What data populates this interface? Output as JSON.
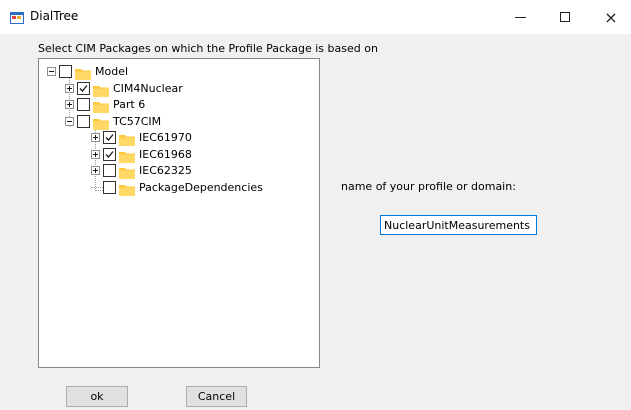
{
  "window": {
    "title": "DialTree",
    "icon": "app-window-icon",
    "controls": {
      "minimize": "minimize-icon",
      "maximize": "maximize-icon",
      "close": "×"
    }
  },
  "instruction": "Select CIM Packages on which the Profile Package is based on",
  "tree": {
    "nodes": [
      {
        "label": "Model",
        "checked": false,
        "expanded": true,
        "level": 0
      },
      {
        "label": "CIM4Nuclear",
        "checked": true,
        "expanded": false,
        "level": 1
      },
      {
        "label": "Part 6",
        "checked": false,
        "expanded": false,
        "level": 1
      },
      {
        "label": "TC57CIM",
        "checked": false,
        "expanded": true,
        "level": 1
      },
      {
        "label": "IEC61970",
        "checked": true,
        "expanded": false,
        "level": 2
      },
      {
        "label": "IEC61968",
        "checked": true,
        "expanded": false,
        "level": 2
      },
      {
        "label": "IEC62325",
        "checked": false,
        "expanded": false,
        "level": 2
      },
      {
        "label": "PackageDependencies",
        "checked": false,
        "expanded": null,
        "level": 2
      }
    ]
  },
  "profile": {
    "label": "name of your profile or domain:",
    "value": "NuclearUnitMeasurements"
  },
  "buttons": {
    "ok": "ok",
    "cancel": "Cancel"
  },
  "colors": {
    "folder": "#ffc83d",
    "input_border": "#0078d7",
    "window_bg": "#f0f0f0"
  }
}
